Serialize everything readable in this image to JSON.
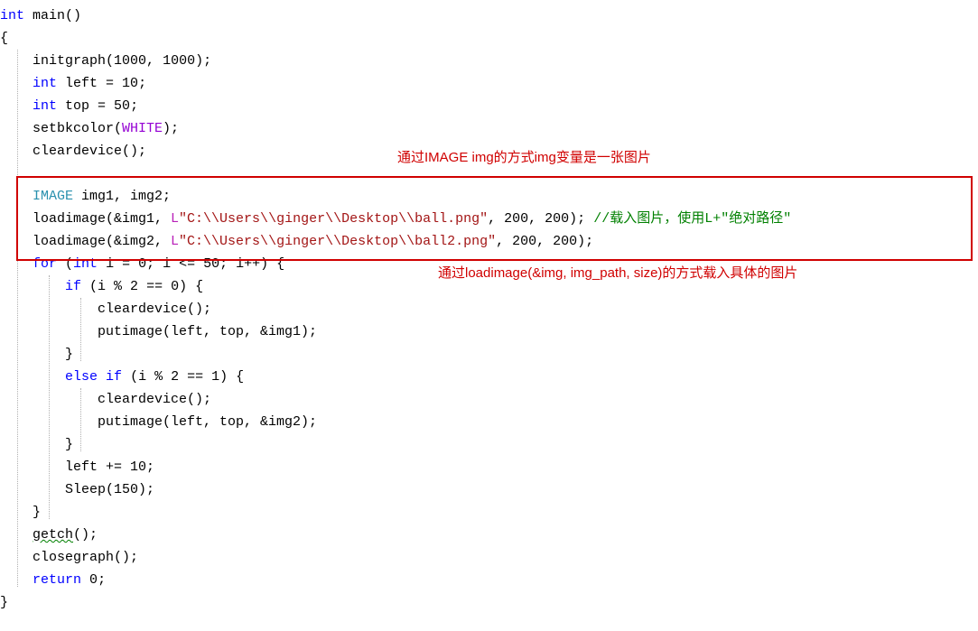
{
  "annotations": {
    "top": "通过IMAGE img的方式img变量是一张图片",
    "bottom": "通过loadimage(&img, img_path, size)的方式载入具体的图片"
  },
  "code": {
    "l1_kw1": "int",
    "l1_fn": " main",
    "l1_rest": "()",
    "l2": "{",
    "l3_pre": "    initgraph(",
    "l3_n1": "1000",
    "l3_m": ", ",
    "l3_n2": "1000",
    "l3_end": ");",
    "l4_pre": "    ",
    "l4_kw": "int",
    "l4_m": " left = ",
    "l4_n": "10",
    "l4_end": ";",
    "l5_pre": "    ",
    "l5_kw": "int",
    "l5_m": " top = ",
    "l5_n": "50",
    "l5_end": ";",
    "l6_pre": "    setbkcolor(",
    "l6_c": "WHITE",
    "l6_end": ");",
    "l7": "    cleardevice();",
    "l8": "",
    "l9_pre": "    ",
    "l9_t": "IMAGE",
    "l9_rest": " img1, img2;",
    "l10_pre": "    loadimage(&img1, ",
    "l10_L": "L",
    "l10_s": "\"C:\\\\Users\\\\ginger\\\\Desktop\\\\ball.png\"",
    "l10_m": ", ",
    "l10_n1": "200",
    "l10_m2": ", ",
    "l10_n2": "200",
    "l10_end": "); ",
    "l10_c": "//载入图片，使用L+\"绝对路径\"",
    "l11_pre": "    loadimage(&img2, ",
    "l11_L": "L",
    "l11_s": "\"C:\\\\Users\\\\ginger\\\\Desktop\\\\ball2.png\"",
    "l11_m": ", ",
    "l11_n1": "200",
    "l11_m2": ", ",
    "l11_n2": "200",
    "l11_end": ");",
    "l12_pre": "    ",
    "l12_kw1": "for",
    "l12_m1": " (",
    "l12_kw2": "int",
    "l12_m2": " i = ",
    "l12_n1": "0",
    "l12_m3": "; i <= ",
    "l12_n2": "50",
    "l12_m4": "; i++) {",
    "l13_pre": "        ",
    "l13_kw": "if",
    "l13_m": " (i % ",
    "l13_n1": "2",
    "l13_m2": " == ",
    "l13_n2": "0",
    "l13_end": ") {",
    "l14": "            cleardevice();",
    "l15": "            putimage(left, top, &img1);",
    "l16": "        }",
    "l17_pre": "        ",
    "l17_kw1": "else",
    "l17_m": " ",
    "l17_kw2": "if",
    "l17_m2": " (i % ",
    "l17_n1": "2",
    "l17_m3": " == ",
    "l17_n2": "1",
    "l17_end": ") {",
    "l18": "            cleardevice();",
    "l19": "            putimage(left, top, &img2);",
    "l20": "        }",
    "l21_pre": "        left += ",
    "l21_n": "10",
    "l21_end": ";",
    "l22_pre": "        Sleep(",
    "l22_n": "150",
    "l22_end": ");",
    "l23": "    }",
    "l24_pre": "    ",
    "l24_fn": "getch",
    "l24_end": "();",
    "l25": "    closegraph();",
    "l26_pre": "    ",
    "l26_kw": "return",
    "l26_m": " ",
    "l26_n": "0",
    "l26_end": ";",
    "l27": "}"
  }
}
